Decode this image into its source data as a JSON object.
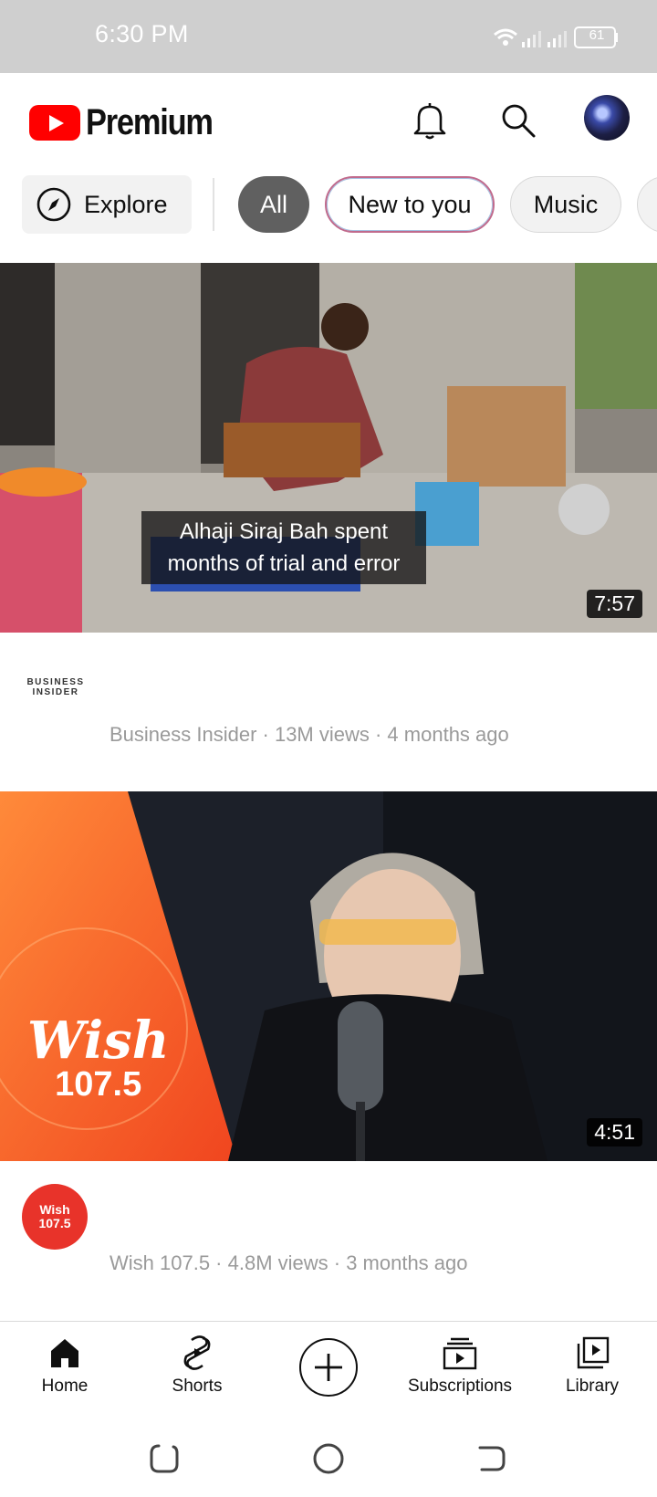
{
  "status_bar": {
    "time": "6:30 PM",
    "battery": "61"
  },
  "header": {
    "brand": "Premium",
    "icons": [
      "notifications-bell-icon",
      "search-icon",
      "account-avatar"
    ]
  },
  "chips": {
    "explore": "Explore",
    "items": [
      "All",
      "New to you",
      "Music"
    ]
  },
  "videos": [
    {
      "caption": "Alhaji Siraj Bah spent months of trial and error",
      "duration": "7:57",
      "channel_logo_text": "BUSINESS INSIDER",
      "meta": "Business Insider · 13M views · 4 months ago"
    },
    {
      "thumb_brand": "Wish",
      "thumb_freq": "107.5",
      "duration": "4:51",
      "channel_logo_text": "Wish 107.5",
      "meta": "Wish 107.5 · 4.8M views · 3 months ago"
    }
  ],
  "bottom_nav": {
    "home": "Home",
    "shorts": "Shorts",
    "subscriptions": "Subscriptions",
    "library": "Library"
  },
  "colors": {
    "brand_red": "#ff0000",
    "chip_selected": "#606060",
    "wish_orange": "#e8332a"
  }
}
